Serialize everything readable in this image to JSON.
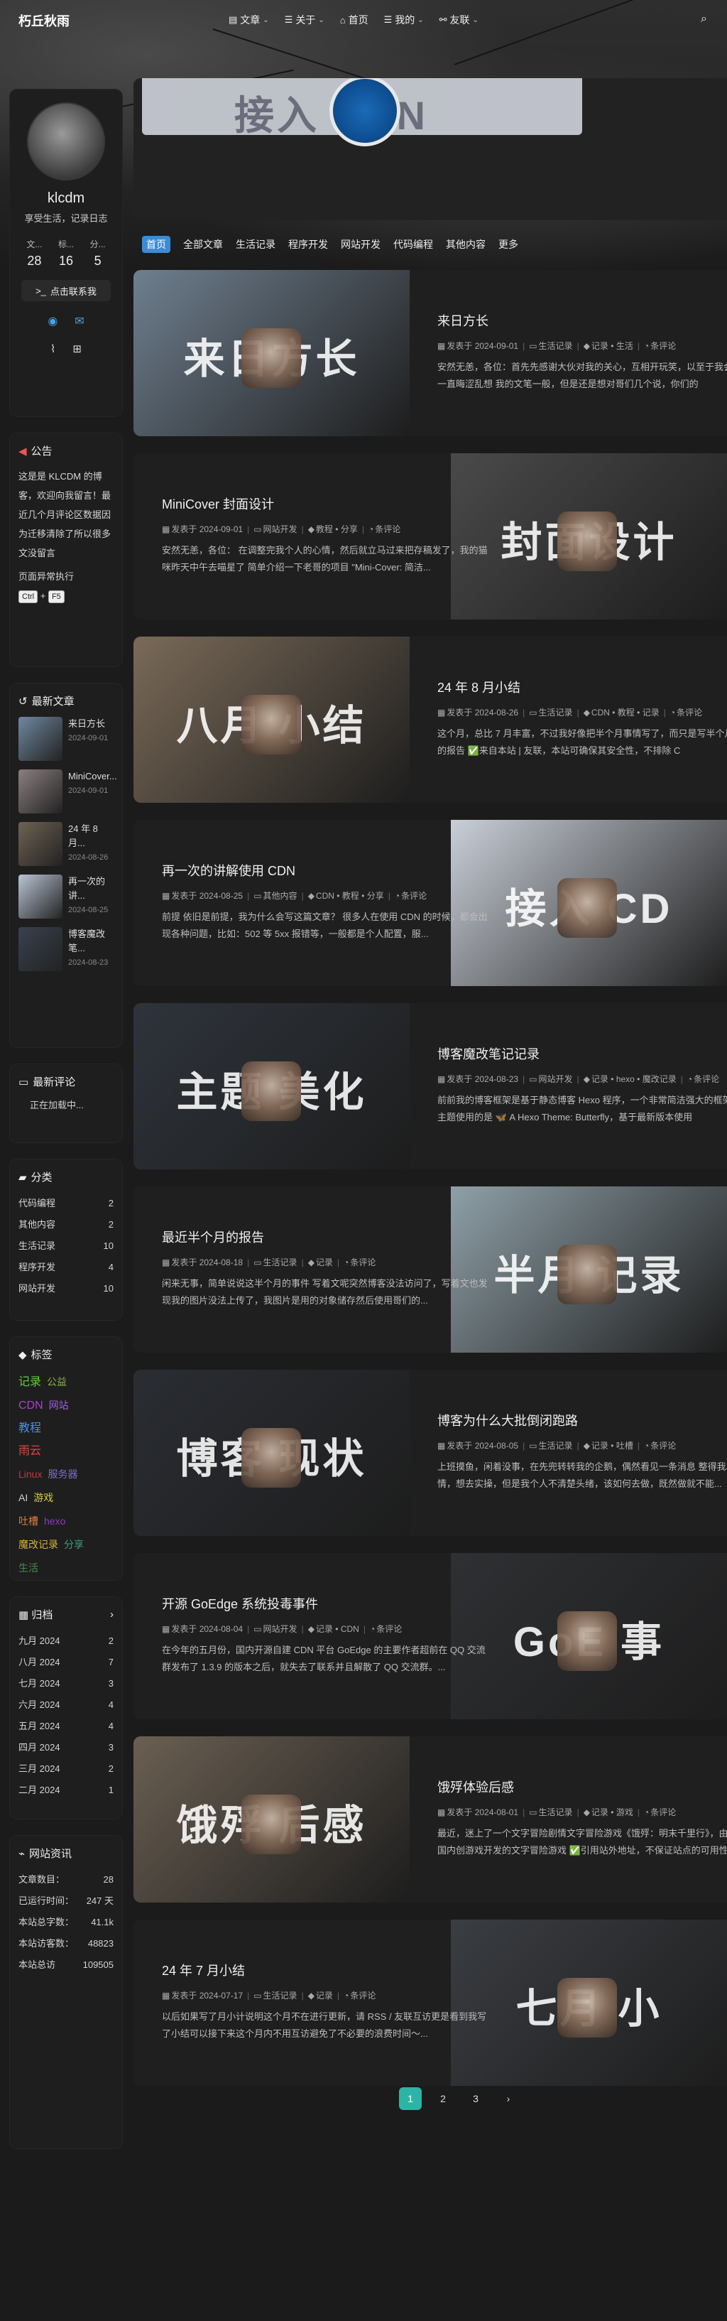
{
  "nav": {
    "brand": "朽丘秋雨",
    "menu": [
      {
        "label": "文章",
        "icon": "book-icon",
        "glyph": "▤",
        "dropdown": true
      },
      {
        "label": "关于",
        "icon": "list-icon",
        "glyph": "☰",
        "dropdown": true
      },
      {
        "label": "首页",
        "icon": "home-icon",
        "glyph": "⌂",
        "dropdown": false
      },
      {
        "label": "我的",
        "icon": "list-icon",
        "glyph": "☰",
        "dropdown": true
      },
      {
        "label": "友联",
        "icon": "link-icon",
        "glyph": "⚯",
        "dropdown": true
      }
    ]
  },
  "author": {
    "name": "klcdm",
    "description": "享受生活，记录日志",
    "stats": [
      {
        "label": "文...",
        "value": "28"
      },
      {
        "label": "标...",
        "value": "16"
      },
      {
        "label": "分...",
        "value": "5"
      }
    ],
    "contact_label": "点击联系我"
  },
  "announcement": {
    "title": "公告",
    "text": "这是是 KLCDM 的博客，欢迎向我留言！最近几个月评论区数据因为迁移清除了所以很多文没留言",
    "shortcut_text": "页面异常执行",
    "keys": [
      "Ctrl",
      "F5"
    ]
  },
  "recent": {
    "title": "最新文章",
    "items": [
      {
        "title": "来日方长",
        "date": "2024-09-01",
        "color": "#6f88a0"
      },
      {
        "title": "MiniCover...",
        "date": "2024-09-01",
        "color": "#8a7f80"
      },
      {
        "title": "24 年 8 月...",
        "date": "2024-08-26",
        "color": "#6e6253"
      },
      {
        "title": "再一次的讲...",
        "date": "2024-08-25",
        "color": "#b9c4d6"
      },
      {
        "title": "博客魔改笔...",
        "date": "2024-08-23",
        "color": "#39424f"
      }
    ]
  },
  "comments": {
    "title": "最新评论",
    "loading": "正在加载中..."
  },
  "categories": {
    "title": "分类",
    "items": [
      {
        "name": "代码编程",
        "count": "2"
      },
      {
        "name": "其他内容",
        "count": "2"
      },
      {
        "name": "生活记录",
        "count": "10"
      },
      {
        "name": "程序开发",
        "count": "4"
      },
      {
        "name": "网站开发",
        "count": "10"
      }
    ]
  },
  "tags": {
    "title": "标签",
    "items": [
      {
        "name": "记录",
        "color": "#5bd13c",
        "small": false
      },
      {
        "name": "公益",
        "color": "#8cb04a",
        "small": true
      },
      {
        "name": "CDN",
        "color": "#b23bd6",
        "small": false
      },
      {
        "name": "网站",
        "color": "#a35de0",
        "small": true
      },
      {
        "name": "教程",
        "color": "#4c8fe8",
        "small": false
      },
      {
        "name": "雨云",
        "color": "#d94a44",
        "small": false
      },
      {
        "name": "Linux",
        "color": "#c0393b",
        "small": true
      },
      {
        "name": "服务器",
        "color": "#7b70c8",
        "small": true
      },
      {
        "name": "AI",
        "color": "#cfcfcf",
        "small": true
      },
      {
        "name": "游戏",
        "color": "#d9c84a",
        "small": true
      },
      {
        "name": "吐槽",
        "color": "#e07d3c",
        "small": true
      },
      {
        "name": "hexo",
        "color": "#8a3fb8",
        "small": true
      },
      {
        "name": "魔改记录",
        "color": "#d4b23a",
        "small": true
      },
      {
        "name": "分享",
        "color": "#3c9e7a",
        "small": true
      },
      {
        "name": "生活",
        "color": "#4a8a4a",
        "small": true
      }
    ]
  },
  "archives": {
    "title": "归档",
    "items": [
      {
        "name": "九月 2024",
        "count": "2"
      },
      {
        "name": "八月 2024",
        "count": "7"
      },
      {
        "name": "七月 2024",
        "count": "3"
      },
      {
        "name": "六月 2024",
        "count": "4"
      },
      {
        "name": "五月 2024",
        "count": "4"
      },
      {
        "name": "四月 2024",
        "count": "3"
      },
      {
        "name": "三月 2024",
        "count": "2"
      },
      {
        "name": "二月 2024",
        "count": "1"
      }
    ]
  },
  "siteinfo": {
    "title": "网站资讯",
    "items": [
      {
        "name": "文章数目：",
        "value": "28"
      },
      {
        "name": "已运行时间：",
        "value": "247 天"
      },
      {
        "name": "本站总字数：",
        "value": "41.1k"
      },
      {
        "name": "本站访客数：",
        "value": "48823"
      },
      {
        "name": "本站总访",
        "value": "109505"
      }
    ]
  },
  "banner": {
    "text": "接入 CDN"
  },
  "category_bar": {
    "items": [
      "首页",
      "全部文章",
      "生活记录",
      "程序开发",
      "网站开发",
      "代码编程",
      "其他内容",
      "更多"
    ]
  },
  "posts": [
    {
      "side": "left",
      "cover_text": "来日方长",
      "cover_color": "#6f7f8f",
      "title": "来日方长",
      "date": "2024-09-01",
      "category": "生活记录",
      "tags": [
        "记录",
        "生活"
      ],
      "comments": "条评论",
      "excerpt": "安然无恙，各位：首先先感谢大伙对我的关心，互相开玩笑，以至于我会一直晦涩乱想 我的文笔一般，但是还是想对哥们几个说，你们的"
    },
    {
      "side": "right",
      "cover_text": "封面设计",
      "cover_color": "#4a4a4a",
      "title": "MiniCover 封面设计",
      "date": "2024-09-01",
      "category": "网站开发",
      "tags": [
        "教程",
        "分享"
      ],
      "comments": "条评论",
      "excerpt": "安然无恙，各位： 在调整完我个人的心情，然后就立马过来把存稿发了，我的猫咪昨天中午去喵星了 简单介绍一下老哥的项目 \"Mini-Cover: 简洁..."
    },
    {
      "side": "left",
      "cover_text": "八月 小结",
      "cover_color": "#7a6a58",
      "title": "24 年 8 月小结",
      "date": "2024-08-26",
      "category": "生活记录",
      "tags": [
        "CDN",
        "教程",
        "记录"
      ],
      "comments": "条评论",
      "excerpt": "这个月，总比 7 月丰富，不过我好像把半个月事情写了，而只是写半个月的报告 ✅来自本站 | 友联，本站可确保其安全性，不排除 C"
    },
    {
      "side": "right",
      "cover_text": "接入 CD",
      "cover_color": "#c9cfd8",
      "title": "再一次的讲解使用 CDN",
      "date": "2024-08-25",
      "category": "其他内容",
      "tags": [
        "CDN",
        "教程",
        "分享"
      ],
      "comments": "条评论",
      "excerpt": "前提 依旧是前提，我为什么会写这篇文章？ 很多人在使用 CDN 的时候，都会出现各种问题，比如：502 等 5xx 报错等，一般都是个人配置，服..."
    },
    {
      "side": "left",
      "cover_text": "主题 美化",
      "cover_color": "#2e343c",
      "title": "博客魔改笔记记录",
      "date": "2024-08-23",
      "category": "网站开发",
      "tags": [
        "记录",
        "hexo",
        "魔改记录"
      ],
      "comments": "条评论",
      "excerpt": "前前我的博客框架是基于静态博客 Hexo 程序，一个非常简洁强大的框架 主题使用的是 🦋 A Hexo Theme: Butterfly，基于最新版本使用"
    },
    {
      "side": "right",
      "cover_text": "半月 记录",
      "cover_color": "#8fa0a8",
      "title": "最近半个月的报告",
      "date": "2024-08-18",
      "category": "生活记录",
      "tags": [
        "记录"
      ],
      "comments": "条评论",
      "excerpt": "闲来无事，简单说说这半个月的事件 写着文呢突然博客没法访问了，写着文也发现我的图片没法上传了，我图片是用的对象储存然后使用哥们的..."
    },
    {
      "side": "left",
      "cover_text": "博客 现状",
      "cover_color": "#2a2d33",
      "title": "博客为什么大批倒闭跑路",
      "date": "2024-08-05",
      "category": "生活记录",
      "tags": [
        "记录",
        "吐槽"
      ],
      "comments": "条评论",
      "excerpt": "上班摸鱼，闲着没事，在先兜转转我的企鹅，偶然看见一条消息 整得我心情，想去实操，但是我个人不清楚头绪，该如何去做，既然做就不能..."
    },
    {
      "side": "right",
      "cover_text": "GoE 事",
      "cover_color": "#2f3033",
      "title": "开源 GoEdge 系统投毒事件",
      "date": "2024-08-04",
      "category": "网站开发",
      "tags": [
        "记录",
        "CDN"
      ],
      "comments": "条评论",
      "excerpt": "在今年的五月份，国内开源自建 CDN 平台 GoEdge 的主要作者超前在 QQ 交流群发布了 1.3.9 的版本之后，就失去了联系并且解散了 QQ 交流群。..."
    },
    {
      "side": "left",
      "cover_text": "饿殍 后感",
      "cover_color": "#6a5f52",
      "title": "饿殍体验后感",
      "date": "2024-08-01",
      "category": "生活记录",
      "tags": [
        "记录",
        "游戏"
      ],
      "comments": "条评论",
      "excerpt": "最近，迷上了一个文字冒险剧情文字冒险游戏《饿殍：明末千里行》，由国内创游戏开发的文字冒险游戏 ✅引用站外地址，不保证站点的可用性"
    },
    {
      "side": "right",
      "cover_text": "七月 小",
      "cover_color": "#3a3d42",
      "title": "24 年 7 月小结",
      "date": "2024-07-17",
      "category": "生活记录",
      "tags": [
        "记录"
      ],
      "comments": "条评论",
      "excerpt": "以后如果写了月小计说明这个月不在进行更新，请 RSS / 友联互访更是看到我写了小结可以接下来这个月内不用互访避免了不必要的浪费时间～..."
    }
  ],
  "pagination": {
    "pages": [
      "1",
      "2",
      "3"
    ],
    "current": "1",
    "next": "›"
  },
  "colors": {
    "accent": "#3b8cd6",
    "pager_active": "#2bb5a6",
    "notice_icon": "#e55555"
  }
}
